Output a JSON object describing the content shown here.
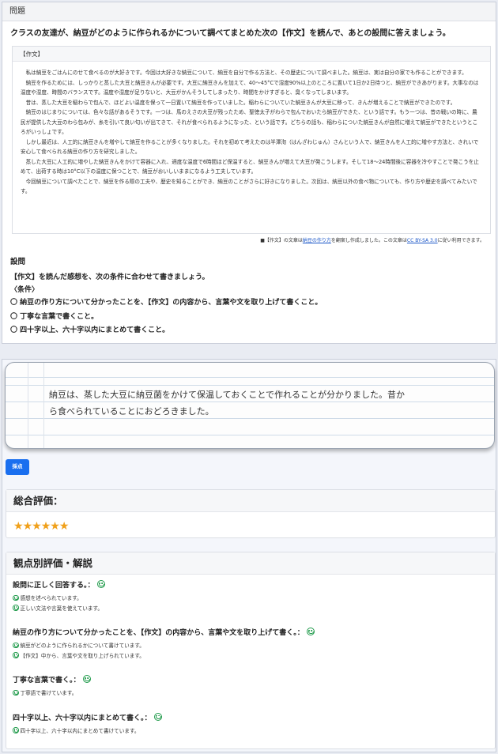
{
  "problem": {
    "header": "問題",
    "lead": "クラスの友達が、納豆がどのように作られるかについて調べてまとめた次の【作文】を読んで、あとの設問に答えましょう。",
    "essay_header": "【作文】",
    "essay_paragraphs": [
      "私は納豆をごはんにのせて食べるのが大好きです。今回は大好きな納豆について、納豆を自分で作る方法と、その歴史について調べました。納豆は、実は自分の家でも作ることができます。",
      "納豆を作るためには、しっかりと蒸した大豆と納豆きんが必要です。大豆に納豆きんを加えて、40～45°Cで湿度90%以上のところに置いて1日か2日待つと、納豆ができあがります。大事なのは温度や湿度、時間のバランスです。温度や湿度が足りないと、大豆がかんそうしてしまったり、時間をかけすぎると、臭くなってしまいます。",
      "昔は、蒸した大豆を稲わらで包んで、ほどよい温度を保って一日置いて納豆を作っていました。稲わらについていた納豆きんが大豆に移って、きんが増えることで納豆ができたのです。",
      "納豆のはじまりについては、色々な話があるそうです。一つは、馬のえさの大豆が残ったため、聖徳太子がわらで包んでおいたら納豆ができた、という話です。もう一つは、昔の戦いの時に、農民が提供した大豆のわら包みが、糸を引いて良い匂いが出てきて、それが食べられるようになった、という話です。どちらの話も、稲わらについた納豆きんが自然に増えて納豆ができたというところがいっしょです。",
      "しかし最近は、人工的に納豆きんを増やして納豆を作ることが多くなりました。それを初めて考えたのは半澤洵（はんざわじゅん）さんという人で、納豆きんを人工的に増やす方法と、きれいで安心して食べられる納豆の作り方を研究しました。",
      "蒸した大豆に人工的に増やした納豆きんをかけて容器に入れ、適度な温度で6時間ほど保温すると、納豆きんが増えて大豆が発こうします。そして18～24時間後に容器を冷やすことで発こうを止めて、出荷する時は10°C以下の温度に保つことで、納豆がおいしいままになるよう工夫しています。",
      "今回納豆について調べたことで、納豆を作る際の工夫や、歴史を知ることができ、納豆のことがさらに好きになりました。次回は、納豆以外の食べ物についても、作り方や歴史を調べてみたいです。"
    ],
    "credit_prefix": "■【作文】の文章は",
    "credit_link1": "納豆の作り方",
    "credit_middle": "を翻案し作成しました。この文章は",
    "credit_link2": "CC BY-SA 3.0",
    "credit_suffix": "に従い利用できます。",
    "question_title": "設問",
    "question_text": "【作文】を読んだ感想を、次の条件に合わせて書きましょう。",
    "conditions_label": "〈条件〉",
    "conditions": [
      "〇 納豆の作り方について分かったことを、【作文】の内容から、言葉や文を取り上げて書くこと。",
      "〇 丁寧な言葉で書くこと。",
      "〇 四十字以上、六十字以内にまとめて書くこと。"
    ]
  },
  "answer": {
    "line1": "納豆は、蒸した大豆に納豆菌をかけて保温しておくことで作れることが分かりました。昔か",
    "line2": "ら食べられていることにおどろきました。"
  },
  "grade_button": "採点",
  "overall": {
    "title": "総合評価：",
    "stars": 6
  },
  "detail": {
    "title": "観点別評価・解説",
    "criteria": [
      {
        "title": "設問に正しく回答する。：",
        "notes": [
          "感想を述べられています。",
          "正しい文法や言葉を使えています。"
        ]
      },
      {
        "title": "納豆の作り方について分かったことを、【作文】の内容から、言葉や文を取り上げて書く。：",
        "notes": [
          "納豆がどのように作られるかについて書けています。",
          "【作文】中から、言葉や文を取り上げられています。"
        ]
      },
      {
        "title": "丁寧な言葉で書く。：",
        "notes": [
          "丁寧語で書けています。"
        ]
      },
      {
        "title": "四十字以上、六十字以内にまとめて書く。：",
        "notes": [
          "四十字以上、六十字以内にまとめて書けています。"
        ]
      }
    ]
  },
  "colors": {
    "accent": "#1a6fef",
    "star": "#f0a01a",
    "good": "#1f9a4a"
  },
  "icons": {
    "rating": "star-icon",
    "evaluation": "smiley-face-icon"
  }
}
